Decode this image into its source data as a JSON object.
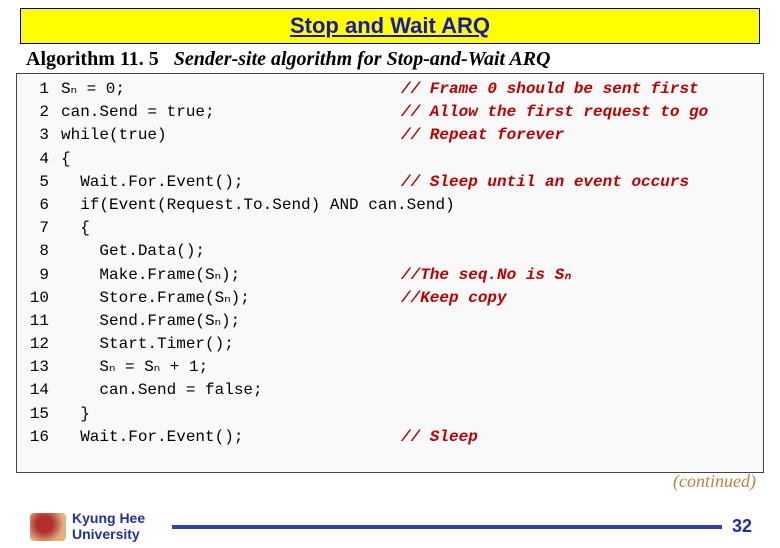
{
  "banner_title": "Stop and Wait ARQ",
  "algorithm_label": "Algorithm 11. 5",
  "algorithm_subtitle": "Sender-site algorithm for Stop-and-Wait ARQ",
  "code": {
    "lines": [
      {
        "n": "1",
        "c": "Sₙ = 0;",
        "m": "// Frame 0 should be sent first"
      },
      {
        "n": "2",
        "c": "can.Send = true;",
        "m": "// Allow the first request to go"
      },
      {
        "n": "3",
        "c": "while(true)",
        "m": "// Repeat forever"
      },
      {
        "n": "4",
        "c": "{",
        "m": ""
      },
      {
        "n": "5",
        "c": "  Wait.For.Event();",
        "m": "// Sleep until an event occurs"
      },
      {
        "n": "6",
        "c": "  if(Event(Request.To.Send) AND can.Send)",
        "m": ""
      },
      {
        "n": "7",
        "c": "  {",
        "m": ""
      },
      {
        "n": "8",
        "c": "    Get.Data();",
        "m": ""
      },
      {
        "n": "9",
        "c": "    Make.Frame(Sₙ);",
        "m": "//The seq.No is Sₙ"
      },
      {
        "n": "10",
        "c": "    Store.Frame(Sₙ);",
        "m": "//Keep copy"
      },
      {
        "n": "11",
        "c": "    Send.Frame(Sₙ);",
        "m": ""
      },
      {
        "n": "12",
        "c": "    Start.Timer();",
        "m": ""
      },
      {
        "n": "13",
        "c": "    Sₙ = Sₙ + 1;",
        "m": ""
      },
      {
        "n": "14",
        "c": "    can.Send = false;",
        "m": ""
      },
      {
        "n": "15",
        "c": "  }",
        "m": ""
      },
      {
        "n": "16",
        "c": "  Wait.For.Event();",
        "m": "// Sleep"
      }
    ]
  },
  "continued_text": "(continued)",
  "university": {
    "l1": "Kyung Hee",
    "l2": "University"
  },
  "page_number": "32"
}
